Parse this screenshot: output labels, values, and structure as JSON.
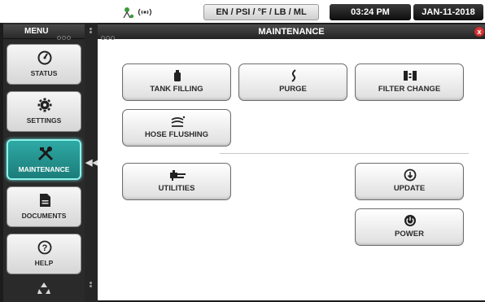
{
  "status_bar": {
    "network_icon": "network-wifi-icon",
    "units": "EN / PSI / °F / LB / ML",
    "time": "03:24 PM",
    "date": "JAN-11-2018"
  },
  "menu": {
    "title": "MENU",
    "items": [
      {
        "label": "STATUS",
        "icon": "gauge-icon"
      },
      {
        "label": "SETTINGS",
        "icon": "gear-icon"
      },
      {
        "label": "MAINTENANCE",
        "icon": "tools-icon"
      },
      {
        "label": "DOCUMENTS",
        "icon": "document-icon"
      },
      {
        "label": "HELP",
        "icon": "help-icon"
      }
    ],
    "active": "MAINTENANCE",
    "footer_icon": "recycle-icon"
  },
  "panel": {
    "title": "MAINTENANCE",
    "close": "x",
    "buttons": {
      "tank_filling": "TANK FILLING",
      "purge": "PURGE",
      "filter_change": "FILTER CHANGE",
      "hose_flushing": "HOSE FLUSHING",
      "utilities": "UTILITIES",
      "update": "UPDATE",
      "power": "POWER"
    }
  },
  "colors": {
    "active_menu": "#1f8f8b",
    "close_button": "#d22a2a",
    "accent_dots": "#3aa0d8"
  }
}
